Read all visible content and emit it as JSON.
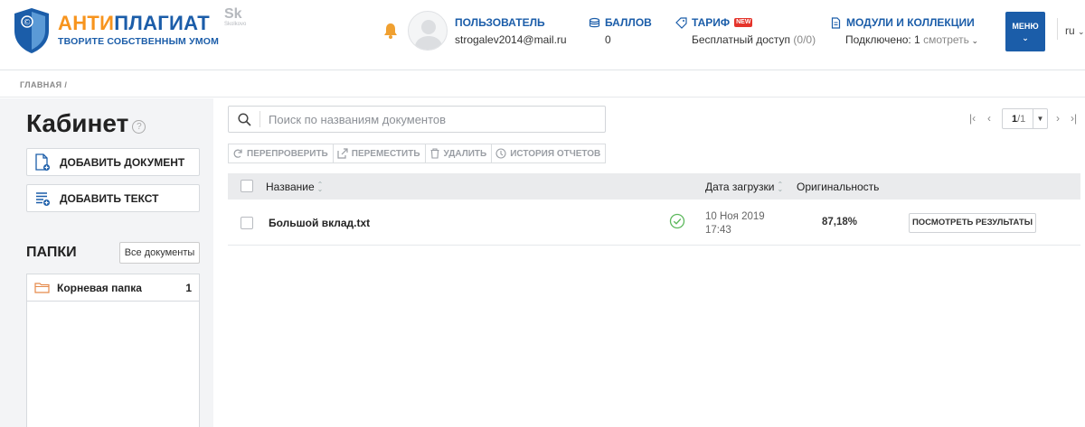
{
  "header": {
    "brand_accent": "АНТИ",
    "brand_rest": "ПЛАГИАТ",
    "tagline": "ТВОРИТЕ СОБСТВЕННЫМ УМОМ",
    "skolkovo_mark": "Sk",
    "skolkovo_text": "Skolkovo",
    "user": {
      "label": "ПОЛЬЗОВАТЕЛЬ",
      "email": "strogalev2014@mail.ru"
    },
    "balance": {
      "label": "БАЛЛОВ",
      "value": "0"
    },
    "tariff": {
      "label": "ТАРИФ",
      "badge": "NEW",
      "value": "Бесплатный доступ",
      "quota": "(0/0)"
    },
    "modules": {
      "label": "МОДУЛИ И КОЛЛЕКЦИИ",
      "value": "Подключено: 1",
      "link": "смотреть"
    },
    "menu_label": "МЕНЮ",
    "language": "ru"
  },
  "breadcrumb": {
    "home": "ГЛАВНАЯ",
    "separator": "/"
  },
  "sidebar": {
    "title": "Кабинет",
    "help": "?",
    "add_document": "ДОБАВИТЬ ДОКУМЕНТ",
    "add_text": "ДОБАВИТЬ ТЕКСТ",
    "folders_title": "ПАПКИ",
    "all_documents": "Все документы",
    "folders": [
      {
        "name": "Корневая папка",
        "count": "1"
      }
    ]
  },
  "search": {
    "placeholder": "Поиск по названиям документов"
  },
  "pager": {
    "current": "1",
    "total": "/1"
  },
  "toolbar": {
    "recheck": "ПЕРЕПРОВЕРИТЬ",
    "move": "ПЕРЕМЕСТИТЬ",
    "delete": "УДАЛИТЬ",
    "history": "ИСТОРИЯ ОТЧЕТОВ"
  },
  "table": {
    "columns": {
      "name": "Название",
      "date": "Дата загрузки",
      "originality": "Оригинальность"
    },
    "rows": [
      {
        "name": "Большой вклад.txt",
        "date": "10 Ноя 2019",
        "time": "17:43",
        "originality": "87,18%",
        "action": "ПОСМОТРЕТЬ РЕЗУЛЬТАТЫ"
      }
    ]
  },
  "colors": {
    "brand_blue": "#1b5da9",
    "brand_orange": "#f7941d",
    "sidebar_bg": "#f3f4f6",
    "success": "#5cb85c"
  }
}
